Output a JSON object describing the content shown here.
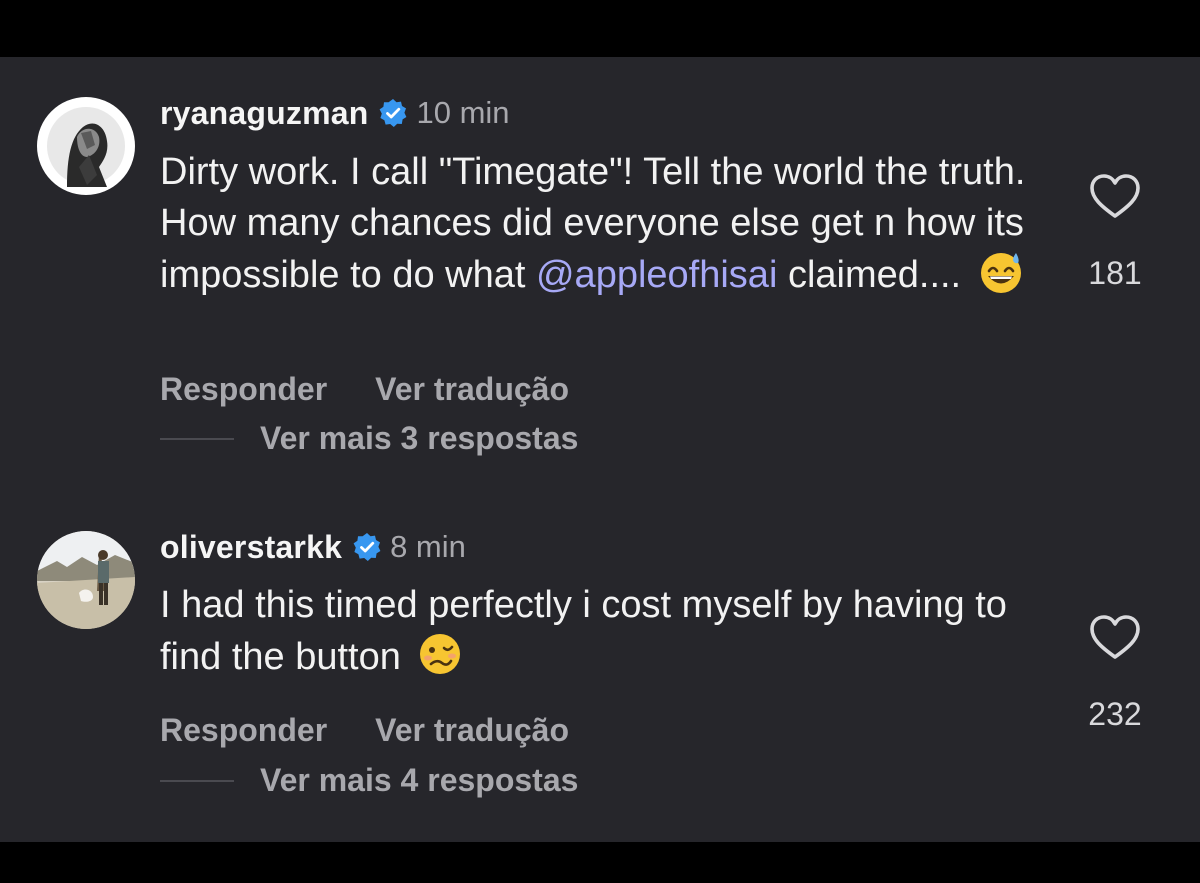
{
  "comments": [
    {
      "username": "ryanaguzman",
      "time": "10 min",
      "text_before": "Dirty work. I call \"Timegate\"! Tell the world the truth. How many chances did everyone else get n how its impossible to do what ",
      "mention": "@appleofhisai",
      "text_after": " claimed....",
      "emoji": "grinning-sweat-emoji",
      "like_count": "181",
      "reply_label": "Responder",
      "translate_label": "Ver tradução",
      "more_replies": "Ver mais 3 respostas"
    },
    {
      "username": "oliverstarkk",
      "time": "8 min",
      "text_before": "I had this timed perfectly i cost myself by having to find the button ",
      "emoji": "woozy-face-emoji",
      "like_count": "232",
      "reply_label": "Responder",
      "translate_label": "Ver tradução",
      "more_replies": "Ver mais 4 respostas"
    }
  ],
  "colors": {
    "background": "#26262b",
    "verified": "#3897f0",
    "mention": "#a7a9f6",
    "secondary_text": "#a8a8ad"
  }
}
